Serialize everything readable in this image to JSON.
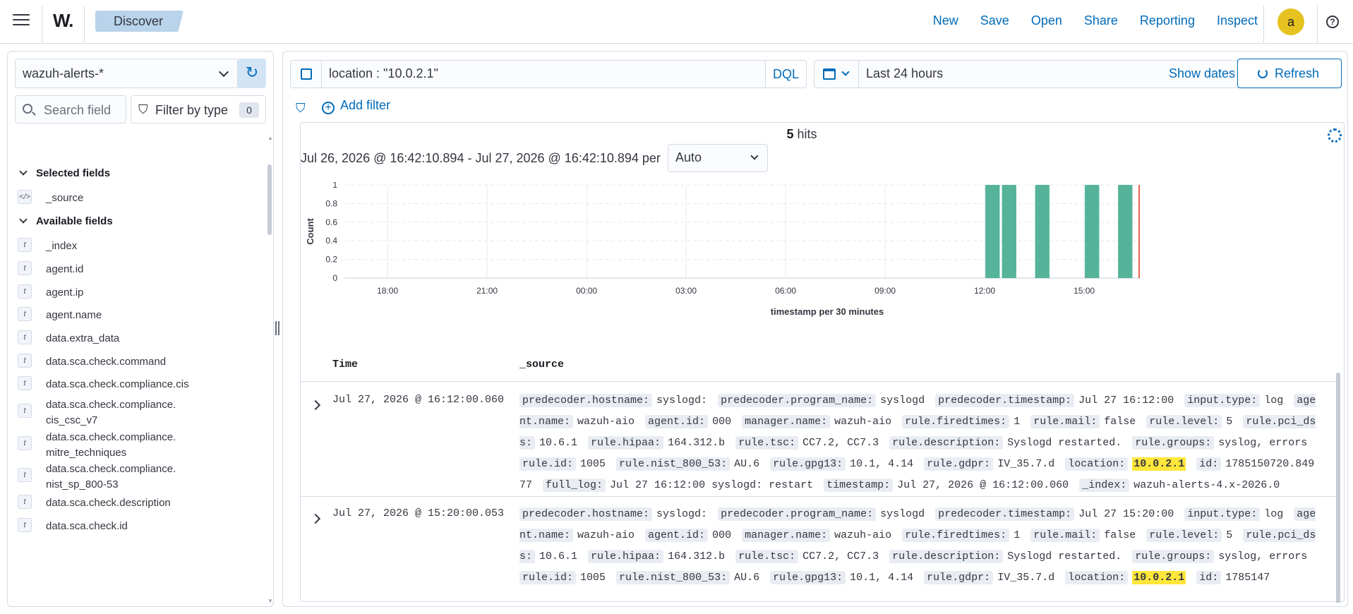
{
  "header": {
    "logo_text": "W.",
    "breadcrumb": "Discover",
    "nav": [
      "New",
      "Save",
      "Open",
      "Share",
      "Reporting",
      "Inspect"
    ],
    "avatar_initial": "a",
    "help_symbol": "?"
  },
  "sidebar": {
    "index_pattern": "wazuh-alerts-*",
    "search_placeholder": "Search field",
    "filter_by_type_label": "Filter by type",
    "filter_count": "0",
    "selected_heading": "Selected fields",
    "available_heading": "Available fields",
    "selected_fields": [
      {
        "name": "_source",
        "icon": "code-icon"
      }
    ],
    "available_fields": [
      {
        "name": "_index",
        "icon": "t"
      },
      {
        "name": "agent.id",
        "icon": "t"
      },
      {
        "name": "agent.ip",
        "icon": "t"
      },
      {
        "name": "agent.name",
        "icon": "t"
      },
      {
        "name": "data.extra_data",
        "icon": "t"
      },
      {
        "name": "data.sca.check.command",
        "icon": "t"
      },
      {
        "name": "data.sca.check.compliance.cis",
        "icon": "t"
      },
      {
        "name": "data.sca.check.compliance.\ncis_csc_v7",
        "icon": "t"
      },
      {
        "name": "data.sca.check.compliance.\nmitre_techniques",
        "icon": "t"
      },
      {
        "name": "data.sca.check.compliance.\nnist_sp_800-53",
        "icon": "t"
      },
      {
        "name": "data.sca.check.description",
        "icon": "t"
      },
      {
        "name": "data.sca.check.id",
        "icon": "t"
      }
    ]
  },
  "query": {
    "text": "location : \"10.0.2.1\"",
    "language": "DQL",
    "time_range": "Last 24 hours",
    "show_dates": "Show dates",
    "refresh": "Refresh",
    "add_filter": "Add filter"
  },
  "results": {
    "hits": "5",
    "hits_label": "hits",
    "interval_text": "Jul 26, 2026 @ 16:42:10.894 - Jul 27, 2026 @ 16:42:10.894 per",
    "interval_value": "Auto",
    "columns": [
      "Time",
      "_source"
    ]
  },
  "chart_data": {
    "type": "bar",
    "xlabel": "timestamp per 30 minutes",
    "ylabel": "Count",
    "ylim": [
      0,
      1
    ],
    "yticks": [
      "0",
      "0.2",
      "0.4",
      "0.6",
      "0.8",
      "1"
    ],
    "xticks": [
      "18:00",
      "21:00",
      "00:00",
      "03:00",
      "06:00",
      "09:00",
      "12:00",
      "15:00"
    ],
    "bars": [
      {
        "start": "12:00",
        "value": 1
      },
      {
        "start": "12:30",
        "value": 1
      },
      {
        "start": "13:30",
        "value": 1
      },
      {
        "start": "15:00",
        "value": 1
      },
      {
        "start": "16:00",
        "value": 1
      }
    ],
    "bar_color": "#54b399",
    "now_marker_color": "#e7664c"
  },
  "rows": [
    {
      "time": "Jul 27, 2026 @ 16:12:00.060",
      "fields": [
        [
          "predecoder.hostname:",
          "syslogd:"
        ],
        [
          "predecoder.program_name:",
          "syslogd"
        ],
        [
          "predecoder.timestamp:",
          "Jul 27 16:12:00"
        ],
        [
          "input.type:",
          "log"
        ],
        [
          "agent.name:",
          "wazuh-aio"
        ],
        [
          "agent.id:",
          "000"
        ],
        [
          "manager.name:",
          "wazuh-aio"
        ],
        [
          "rule.firedtimes:",
          "1"
        ],
        [
          "rule.mail:",
          "false"
        ],
        [
          "rule.level:",
          "5"
        ],
        [
          "rule.pci_dss:",
          "10.6.1"
        ],
        [
          "rule.hipaa:",
          "164.312.b"
        ],
        [
          "rule.tsc:",
          "CC7.2, CC7.3"
        ],
        [
          "rule.description:",
          "Syslogd restarted."
        ],
        [
          "rule.groups:",
          "syslog, errors"
        ],
        [
          "rule.id:",
          "1005"
        ],
        [
          "rule.nist_800_53:",
          "AU.6"
        ],
        [
          "rule.gpg13:",
          "10.1, 4.14"
        ],
        [
          "rule.gdpr:",
          "IV_35.7.d"
        ],
        [
          "location:",
          "10.0.2.1"
        ],
        [
          "id:",
          "1785150720.84977"
        ],
        [
          "full_log:",
          "Jul 27 16:12:00 syslogd: restart"
        ],
        [
          "timestamp:",
          "Jul 27, 2026 @ 16:12:00.060"
        ],
        [
          "_index:",
          "wazuh-alerts-4.x-2026.0"
        ]
      ]
    },
    {
      "time": "Jul 27, 2026 @ 15:20:00.053",
      "fields": [
        [
          "predecoder.hostname:",
          "syslogd:"
        ],
        [
          "predecoder.program_name:",
          "syslogd"
        ],
        [
          "predecoder.timestamp:",
          "Jul 27 15:20:00"
        ],
        [
          "input.type:",
          "log"
        ],
        [
          "agent.name:",
          "wazuh-aio"
        ],
        [
          "agent.id:",
          "000"
        ],
        [
          "manager.name:",
          "wazuh-aio"
        ],
        [
          "rule.firedtimes:",
          "1"
        ],
        [
          "rule.mail:",
          "false"
        ],
        [
          "rule.level:",
          "5"
        ],
        [
          "rule.pci_dss:",
          "10.6.1"
        ],
        [
          "rule.hipaa:",
          "164.312.b"
        ],
        [
          "rule.tsc:",
          "CC7.2, CC7.3"
        ],
        [
          "rule.description:",
          "Syslogd restarted."
        ],
        [
          "rule.groups:",
          "syslog, errors"
        ],
        [
          "rule.id:",
          "1005"
        ],
        [
          "rule.nist_800_53:",
          "AU.6"
        ],
        [
          "rule.gpg13:",
          "10.1, 4.14"
        ],
        [
          "rule.gdpr:",
          "IV_35.7.d"
        ],
        [
          "location:",
          "10.0.2.1"
        ],
        [
          "id:",
          "1785147"
        ]
      ]
    }
  ],
  "highlight_value": "10.0.2.1"
}
